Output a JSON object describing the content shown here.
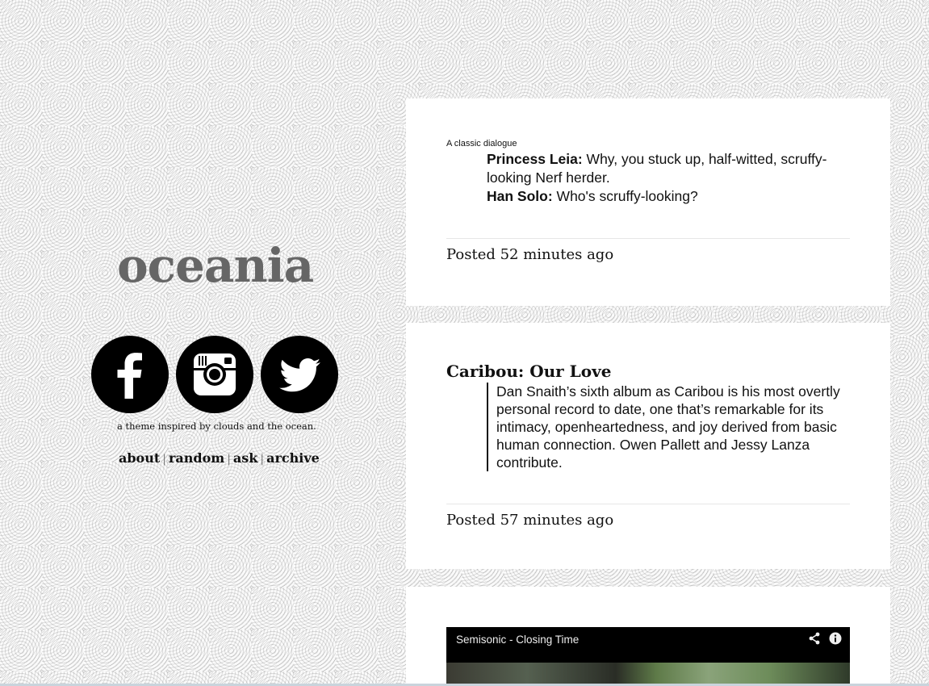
{
  "blog": {
    "title": "oceania",
    "tagline": "a theme inspired by clouds and the ocean.",
    "social": [
      "facebook-icon",
      "instagram-icon",
      "twitter-icon"
    ],
    "nav": {
      "about": "about",
      "random": "random",
      "ask": "ask",
      "archive": "archive",
      "separator": "|"
    }
  },
  "posts": [
    {
      "type": "chat",
      "title": "A classic dialogue",
      "lines": [
        {
          "speaker": "Princess Leia:",
          "text": "Why, you stuck up, half-witted, scruffy-looking Nerf herder."
        },
        {
          "speaker": "Han Solo:",
          "text": "Who's scruffy-looking?"
        }
      ],
      "posted": "Posted 52 minutes ago"
    },
    {
      "type": "link",
      "title": "Caribou: Our Love",
      "quote": "Dan Snaith’s sixth album as Caribou is his most overtly personal record to date, one that’s remarkable for its intimacy, openheartedness, and joy derived from basic human connection. Owen Pallett and Jessy Lanza contribute.",
      "posted": "Posted 57 minutes ago"
    },
    {
      "type": "video",
      "video_title": "Semisonic - Closing Time",
      "icons": [
        "share-icon",
        "info-icon"
      ]
    }
  ]
}
